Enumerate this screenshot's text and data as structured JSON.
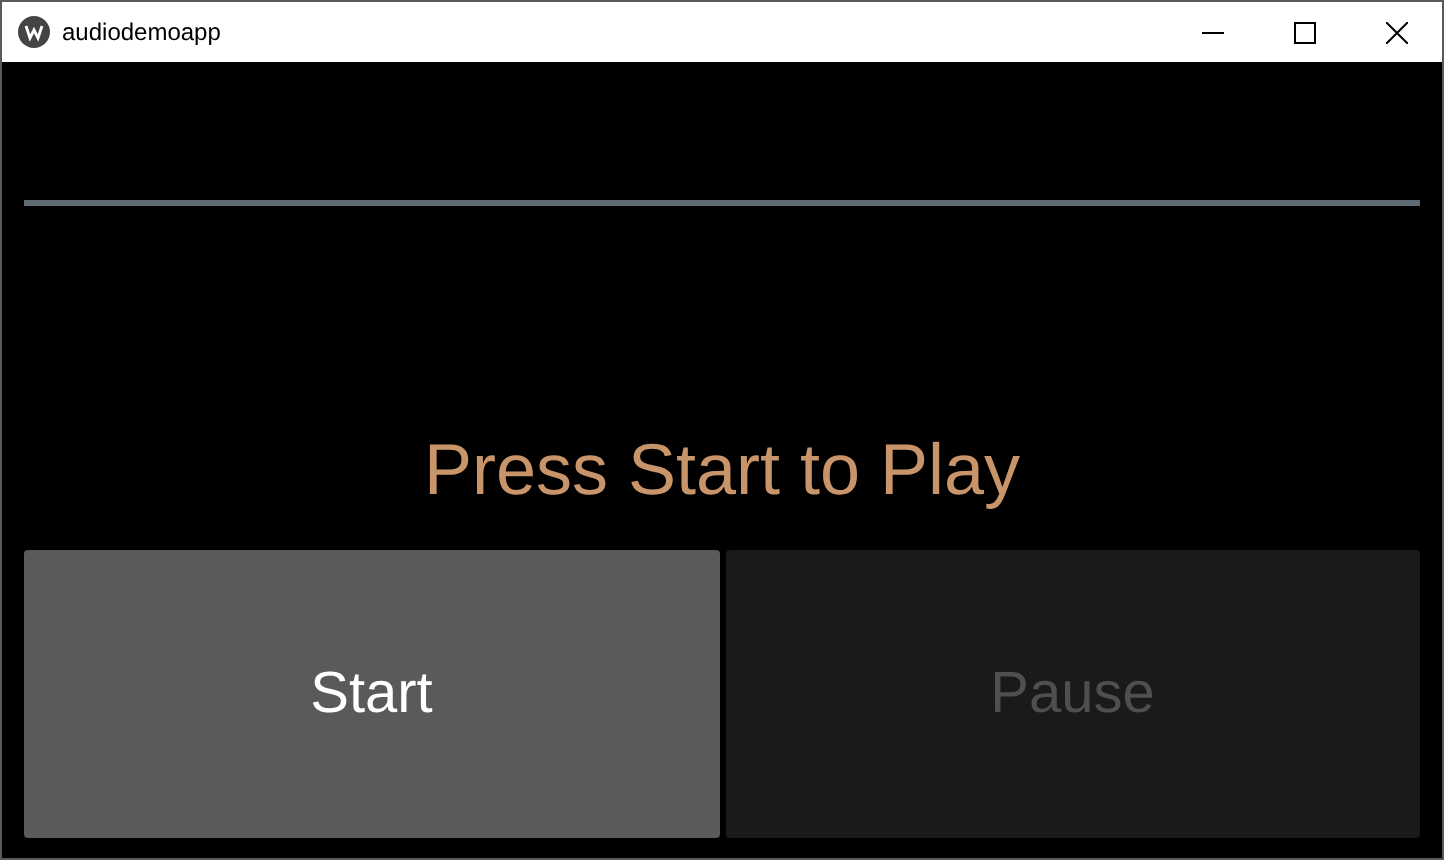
{
  "window": {
    "title": "audiodemoapp"
  },
  "message": "Press Start to Play",
  "buttons": [
    {
      "label": "Start",
      "disabled": false
    },
    {
      "label": "Pause",
      "disabled": true
    }
  ]
}
